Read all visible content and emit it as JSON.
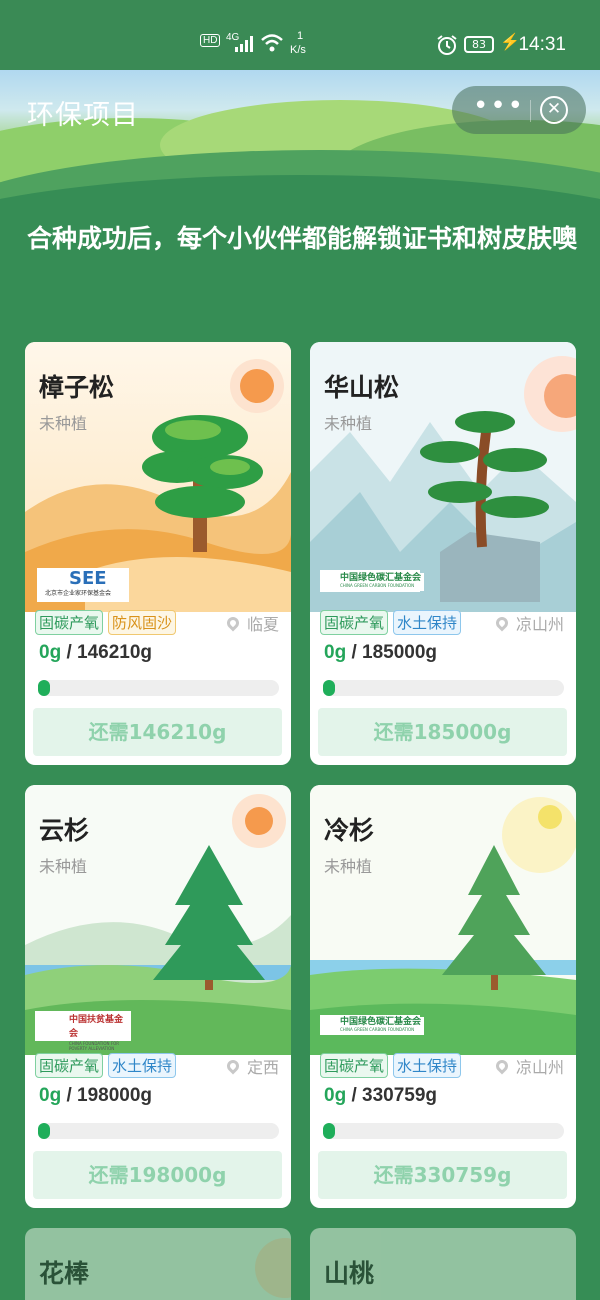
{
  "status_bar": {
    "hd": "HD",
    "net": "4G",
    "speed_value": "1",
    "speed_unit": "K/s",
    "battery": "83",
    "time": "14:31"
  },
  "page": {
    "title": "环保项目",
    "headline": "合种成功后，每个小伙伴都能解锁证书和树皮肤噢"
  },
  "cards": [
    {
      "name": "樟子松",
      "status": "未种植",
      "tags": [
        "固碳产氧",
        "防风固沙"
      ],
      "location": "临夏",
      "current": "0g",
      "target": "146210g",
      "progress": 0,
      "button": "还需146210g",
      "logo": "SEE",
      "logo_sub": "北京市企业家环保基金会"
    },
    {
      "name": "华山松",
      "status": "未种植",
      "tags": [
        "固碳产氧",
        "水土保持"
      ],
      "location": "凉山州",
      "current": "0g",
      "target": "185000g",
      "progress": 0,
      "button": "还需185000g",
      "logo": "中国绿色碳汇基金会",
      "logo_sub": "CHINA GREEN CARBON FOUNDATION"
    },
    {
      "name": "云杉",
      "status": "未种植",
      "tags": [
        "固碳产氧",
        "水土保持"
      ],
      "location": "定西",
      "current": "0g",
      "target": "198000g",
      "progress": 0,
      "button": "还需198000g",
      "logo": "中国扶贫基金会",
      "logo_sub": "CHINA FOUNDATION FOR POVERTY ALLEVIATION"
    },
    {
      "name": "冷杉",
      "status": "未种植",
      "tags": [
        "固碳产氧",
        "水土保持"
      ],
      "location": "凉山州",
      "current": "0g",
      "target": "330759g",
      "progress": 0,
      "button": "还需330759g",
      "logo": "中国绿色碳汇基金会",
      "logo_sub": "CHINA GREEN CARBON FOUNDATION"
    },
    {
      "name": "花棒"
    },
    {
      "name": "山桃"
    }
  ]
}
